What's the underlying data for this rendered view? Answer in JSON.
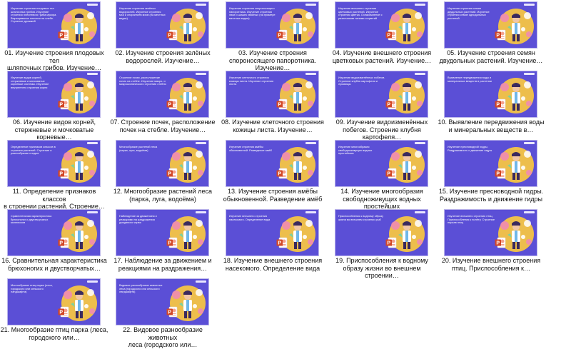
{
  "items": [
    {
      "label": "01. Изучение строения плодовых тел шляпочных грибов. Изучение…",
      "line1": "01. Изучение строения плодовых тел",
      "line2": "шляпочных грибов. Изучение…",
      "thumb_text": "Изучение строения плодовых тел шляпочных грибов. Изучение строения плесневого гриба мукора. Выращивание плесени на хлебе. Строение дрожжей"
    },
    {
      "label": "02. Изучение строения зелёных водорослей. Изучение…",
      "line1": "02. Изучение строения зелёных",
      "line2": "водорослей. Изучение…",
      "thumb_text": "Изучение строения зелёных водорослей. Изучение строения мха и спорангиев мхов (на местных видах)"
    },
    {
      "label": "03. Изучение строения спороносящего папоротника. Изучение…",
      "line1": "03. Изучение строения",
      "line2": "спороносящего папоротника.",
      "line3": "Изучение…",
      "thumb_text": "Изучение строения спороносящего папоротника. Изучение строения хвои и шишек хвойных (на примере местных видов)"
    },
    {
      "label": "04. Изучение внешнего строения цветковых растений. Изучение…",
      "line1": "04. Изучение внешнего строения",
      "line2": "цветковых растений. Изучение…",
      "thumb_text": "Изучение внешнего строения цветковых растений. Изучение строения цветка. Ознакомление с различными типами соцветий"
    },
    {
      "label": "05. Изучение строения семян двудольных растений. Изучение…",
      "line1": "05. Изучение строения семян",
      "line2": "двудольных растений. Изучение…",
      "thumb_text": "Изучение строения семян двудольных растений. Изучение строения семян однодольных растений"
    },
    {
      "label": "06. Изучение видов корней, стержневые и мочковатые корневые…",
      "line1": "06. Изучение видов корней,",
      "line2": "стержневые и мочковатые",
      "line3": "корневые…",
      "thumb_text": "Изучение видов корней, стержневые и мочковатые корневые системы. Изучение внутреннего строения корня"
    },
    {
      "label": "07. Строение почек, расположение почек на стебле. Изучение…",
      "line1": "07. Строение почек, расположение",
      "line2": "почек на стебле. Изучение…",
      "thumb_text": "Строение почек, расположение почек на стебле. Изучение макро- и микроскопического строения стебля"
    },
    {
      "label": "08. Изучение клеточного строения кожицы листа. Изучение…",
      "line1": "08. Изучение клеточного строения",
      "line2": "кожицы листа. Изучение…",
      "thumb_text": "Изучение клеточного строения кожицы листа. Изучение строения листа"
    },
    {
      "label": "09. Изучение видоизменённых побегов. Строение клубня картофеля…",
      "line1": "09. Изучение видоизменённых",
      "line2": "побегов. Строение клубня",
      "line3": "картофеля…",
      "thumb_text": "Изучение видоизменённых побегов. Строение клубня картофеля и луковицы"
    },
    {
      "label": "10. Выявление передвижения воды и минеральных веществ в…",
      "line1": "10. Выявление передвижения воды",
      "line2": "и минеральных веществ в…",
      "thumb_text": "Выявление передвижения воды и минеральных веществ в растении"
    },
    {
      "label": "11. Определение признаков классов в строении растений. Строение…",
      "line1": "11. Определение признаков классов",
      "line2": "в строении растений. Строение…",
      "thumb_text": "Определение признаков классов в строении растений. Строение и разнообразие плодов"
    },
    {
      "label": "12. Многообразие растений леса (парка, луга, водоёма)",
      "line1": "12. Многообразие растений леса",
      "line2": "(парка, луга, водоёма)",
      "thumb_text": "Многообразие растений леса (парка, луга, водоёма)"
    },
    {
      "label": "13. Изучение строения амёбы обыкновенной. Разведение амёб",
      "line1": "13. Изучение строения амёбы",
      "line2": "обыкновенной. Разведение амёб",
      "thumb_text": "Изучение строения амёбы обыкновенной. Разведение амёб"
    },
    {
      "label": "14. Изучение многообразия свободноживущих водных простейших",
      "line1": "14. Изучение многообразия",
      "line2": "свободноживущих водных",
      "line3": "простейших",
      "thumb_text": "Изучение многообразия свободноживущих водных простейших"
    },
    {
      "label": "15. Изучение пресноводной гидры. Раздражимость и движение гидры",
      "line1": "15. Изучение пресноводной гидры.",
      "line2": "Раздражимость и движение гидры",
      "thumb_text": "Изучение пресноводной гидры. Раздражимость и движение гидры"
    },
    {
      "label": "16. Сравнительная характеристика брюхоногих и двустворчатых…",
      "line1": "16. Сравнительная характеристика",
      "line2": "брюхоногих и двустворчатых…",
      "thumb_text": "Сравнительная характеристика брюхоногих и двустворчатых моллюсков"
    },
    {
      "label": "17. Наблюдение за движением и реакциями на раздражения…",
      "line1": "17. Наблюдение за движением и",
      "line2": "реакциями на раздражения…",
      "thumb_text": "Наблюдение за движением и реакциями на раздражения дождевого червя"
    },
    {
      "label": "18. Изучение внешнего строения насекомого. Определение вида",
      "line1": "18. Изучение внешнего строения",
      "line2": "насекомого. Определение вида",
      "thumb_text": "Изучение внешнего строения насекомого. Определение вида"
    },
    {
      "label": "19. Приспособления к водному образу жизни во внешнем строении…",
      "line1": "19. Приспособления к водному",
      "line2": "образу жизни во внешнем",
      "line3": "строении…",
      "thumb_text": "Приспособления к водному образу жизни во внешнем строении рыб"
    },
    {
      "label": "20. Изучение внешнего строения птиц. Приспособления к…",
      "line1": "20. Изучение внешнего строения",
      "line2": "птиц. Приспособления к…",
      "thumb_text": "Изучение внешнего строения птиц. Приспособления к полёту. Строение перьев птиц"
    },
    {
      "label": "21. Многообразие птиц парка (леса, городского или…",
      "line1": "21. Многообразие птиц парка (леса,",
      "line2": "городского или…",
      "thumb_text": "Многообразие птиц парка (леса, городского или сельского ландшафта)"
    },
    {
      "label": "22. Видовое разнообразие животных леса (городского или…",
      "line1": "22. Видовое разнообразие животных",
      "line2": "леса (городского или…",
      "thumb_text": "Видовое разнообразие животных леса (городского или сельского ландшафта)"
    }
  ],
  "colors": {
    "slide_bg": "#5b4fd6",
    "ppt_red": "#d24726",
    "illus_yellow": "#f6c445",
    "illus_pink": "#f08bb1"
  },
  "icons": {
    "file": "powerpoint-file-icon",
    "illustration": "scientist-illustration-icon"
  }
}
